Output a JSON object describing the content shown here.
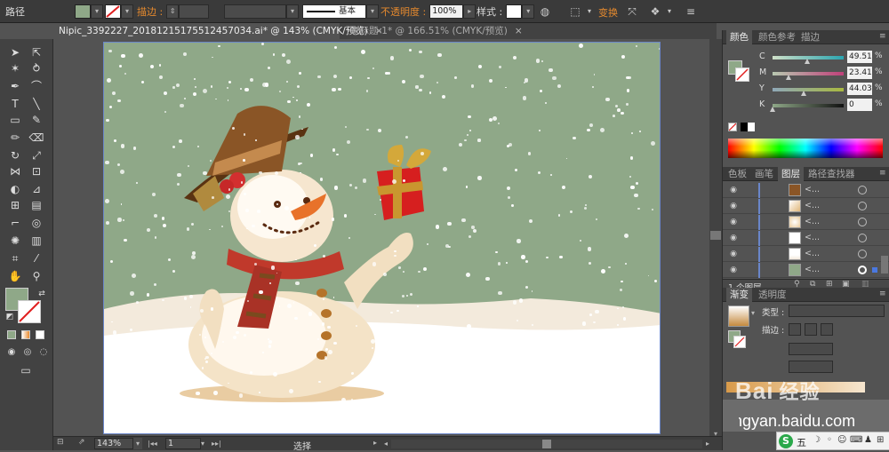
{
  "control_bar": {
    "selection_label": "路径",
    "fill_color": "#8fa888",
    "stroke_label": "描边 :",
    "brush_value": "基本",
    "opacity_label": "不透明度 :",
    "opacity_value": "100%",
    "style_label": "样式 :",
    "transform_label": "变换"
  },
  "tabs": [
    {
      "label": "Nipic_3392227_20181215175512457034.ai* @ 143% (CMYK/预览)",
      "close": "×"
    },
    {
      "label": "未标题-1* @ 166.51% (CMYK/预览)",
      "close": "×"
    }
  ],
  "color_panel": {
    "tabs": [
      "颜色",
      "颜色参考",
      "描边"
    ],
    "channels": [
      {
        "label": "C",
        "value": "49.51",
        "pct": "%",
        "level": 0.49
      },
      {
        "label": "M",
        "value": "23.41",
        "pct": "%",
        "level": 0.23
      },
      {
        "label": "Y",
        "value": "44.03",
        "pct": "%",
        "level": 0.44
      },
      {
        "label": "K",
        "value": "0",
        "pct": "%",
        "level": 0.0
      }
    ]
  },
  "layers_panel": {
    "tabs": [
      "色板",
      "画笔",
      "图层",
      "路径查找器"
    ],
    "rows": [
      "<...",
      "<...",
      "<...",
      "<...",
      "<...",
      "<..."
    ],
    "count_label": "1 个图层"
  },
  "gradient_panel": {
    "tabs": [
      "渐变",
      "透明度"
    ],
    "type_label": "类型 :",
    "stroke_label": "描边 :"
  },
  "status_bar": {
    "zoom": "143%",
    "page": "1",
    "mode": "选择"
  },
  "watermark": {
    "brand": "Bai",
    "product": "经验",
    "domain": "jingyan.baidu.com"
  },
  "ime": {
    "logo": "S",
    "mode": "五"
  },
  "colors": {
    "sky": "#8fa888",
    "snowman_scarf": "#c0392b",
    "hat": "#7a4a1e"
  }
}
